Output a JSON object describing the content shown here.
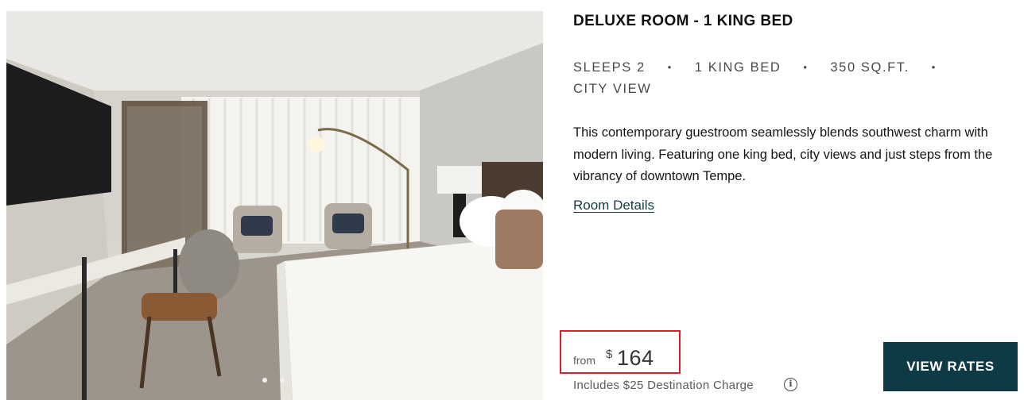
{
  "room": {
    "title": "DELUXE ROOM - 1 KING BED",
    "features": [
      "SLEEPS 2",
      "1 KING BED",
      "350 SQ.FT.",
      "CITY VIEW"
    ],
    "separator": "•",
    "description": "This contemporary guestroom seamlessly blends southwest charm with modern living. Featuring one king bed, city views and just steps from the vibrancy of downtown Tempe.",
    "details_link": "Room Details"
  },
  "price": {
    "from_label": "from",
    "currency": "$",
    "amount": "164",
    "charge_note": "Includes $25 Destination Charge",
    "info_icon": "i"
  },
  "actions": {
    "view_rates_label": "VIEW RATES"
  },
  "photo": {
    "description_icon": "room-photo",
    "carousel_dots": 2,
    "active_dot": 1
  },
  "colors": {
    "button_bg": "#0e3a45",
    "highlight_border": "#e11d2a",
    "link": "#123a47"
  }
}
